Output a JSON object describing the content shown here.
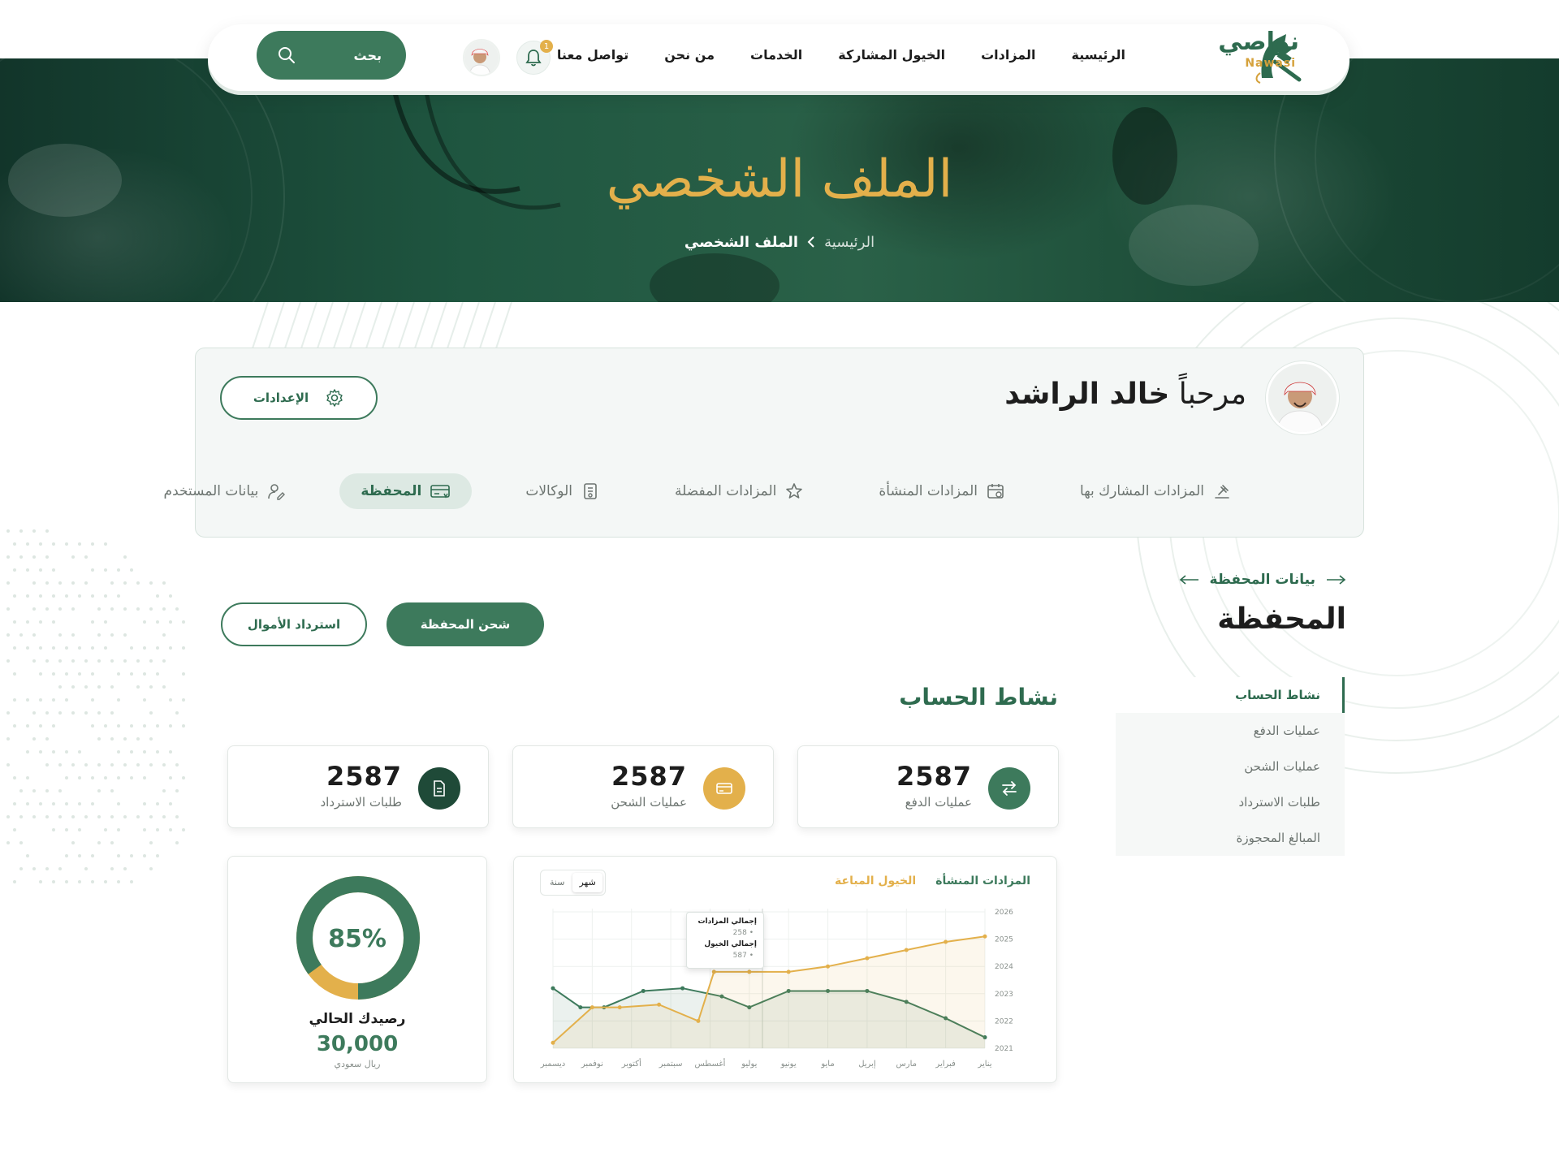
{
  "nav": {
    "logo_text": "نواصي",
    "logo_sub": "Nawasi",
    "links": [
      "الرئيسية",
      "المزادات",
      "الخيول المشاركة",
      "الخدمات",
      "من نحن",
      "تواصل معنا"
    ],
    "notification_count": "1",
    "search_label": "بحث"
  },
  "hero": {
    "title": "الملف الشخصي",
    "breadcrumb": {
      "home": "الرئيسية",
      "current": "الملف الشخصي"
    }
  },
  "profile": {
    "welcome": "مرحباً",
    "name": "خالد الراشد",
    "settings_label": "الإعدادات",
    "tabs": [
      {
        "label": "المزادات المشارك بها",
        "icon": "gavel-icon",
        "active": false
      },
      {
        "label": "المزادات المنشأة",
        "icon": "calendar-icon",
        "active": false
      },
      {
        "label": "المزادات المفضلة",
        "icon": "star-icon",
        "active": false
      },
      {
        "label": "الوكالات",
        "icon": "document-icon",
        "active": false
      },
      {
        "label": "المحفظة",
        "icon": "wallet-icon",
        "active": true
      },
      {
        "label": "بيانات المستخدم",
        "icon": "user-edit-icon",
        "active": false
      }
    ]
  },
  "wallet": {
    "link_label": "بيانات المحفظة",
    "title": "المحفظة",
    "recharge_label": "شحن المحفظة",
    "refund_label": "استرداد الأموال"
  },
  "side_menu": {
    "items": [
      "نشاط الحساب",
      "عمليات الدفع",
      "عمليات الشحن",
      "طلبات الاسترداد",
      "المبالغ المحجوزة"
    ],
    "active_index": 0
  },
  "activity": {
    "title": "نشاط الحساب",
    "stats": [
      {
        "value": "2587",
        "label": "عمليات الدفع",
        "icon": "transfer-icon",
        "color": "#3d7a5c"
      },
      {
        "value": "2587",
        "label": "عمليات الشحن",
        "icon": "card-icon",
        "color": "#e3b04b"
      },
      {
        "value": "2587",
        "label": "طلبات الاسترداد",
        "icon": "file-icon",
        "color": "#1f4a38"
      }
    ]
  },
  "balance": {
    "percent_text": "85%",
    "percent": 85,
    "label": "رصيدك الحالي",
    "value": "30,000",
    "currency": "ريال سعودي"
  },
  "colors": {
    "primary": "#3d7a5c",
    "gold": "#e3b04b",
    "dark": "#1f4a38"
  },
  "chart_data": {
    "type": "line",
    "legend": [
      "المزادات المنشأة",
      "الخيول المباعة"
    ],
    "toggle": {
      "options": [
        "شهر",
        "سنة"
      ],
      "selected": "شهر"
    },
    "categories": [
      "يناير",
      "فبراير",
      "مارس",
      "إبريل",
      "مايو",
      "يونيو",
      "يوليو",
      "أغسطس",
      "سبتمبر",
      "أكتوبر",
      "نوفمبر",
      "ديسمبر"
    ],
    "y_ticks": [
      "2021",
      "2022",
      "2023",
      "2024",
      "2025",
      "2026"
    ],
    "ylim": [
      2021,
      2026
    ],
    "series": [
      {
        "name": "المزادات المنشأة",
        "color": "#3d7a5c",
        "x": [
          0,
          1,
          2,
          3,
          4,
          5,
          6,
          6.7,
          7.7,
          8.7,
          9.7,
          10.3,
          11
        ],
        "y": [
          2021.4,
          2022.1,
          2022.7,
          2023.1,
          2023.1,
          2023.1,
          2022.5,
          2022.9,
          2023.2,
          2023.1,
          2022.5,
          2022.5,
          2023.2
        ]
      },
      {
        "name": "الخيول المباعة",
        "color": "#e3b04b",
        "x": [
          0,
          1,
          2,
          3,
          4,
          5,
          6,
          6.9,
          7.3,
          8.3,
          9.3,
          10,
          11
        ],
        "y": [
          2025.1,
          2024.9,
          2024.6,
          2024.3,
          2024.0,
          2023.8,
          2023.8,
          2023.8,
          2022.0,
          2022.6,
          2022.5,
          2022.5,
          2021.2
        ]
      }
    ],
    "tooltip": {
      "auctions_label": "إجمالي المزادات",
      "auctions_value": "258",
      "horses_label": "إجمالي الخيول",
      "horses_value": "587"
    }
  }
}
